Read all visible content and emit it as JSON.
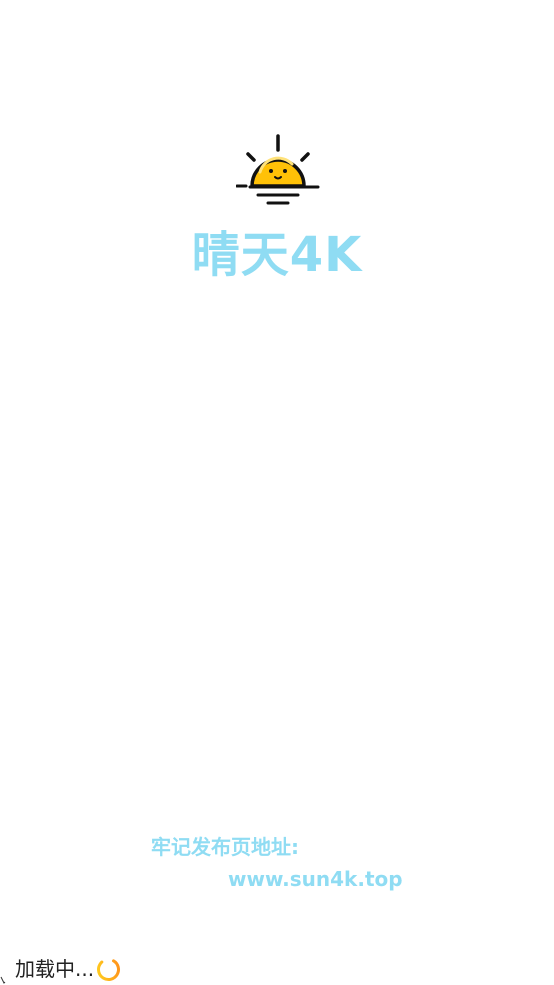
{
  "app": {
    "logo_icon": "sunrise-icon",
    "title": "晴天4K",
    "title_color": "#8fdcf3"
  },
  "notice": {
    "label": "牢记发布页地址:",
    "url": "www.sun4k.top"
  },
  "loading": {
    "text": "加载中...",
    "spinner_icon": "loading-spinner-icon",
    "spinner_colors": [
      "#ff8c1a",
      "#ffd21f"
    ]
  },
  "colors": {
    "sun_fill": "#ffc107",
    "sun_fill_top": "#ffd21f",
    "outline": "#111111",
    "background": "#ffffff"
  }
}
